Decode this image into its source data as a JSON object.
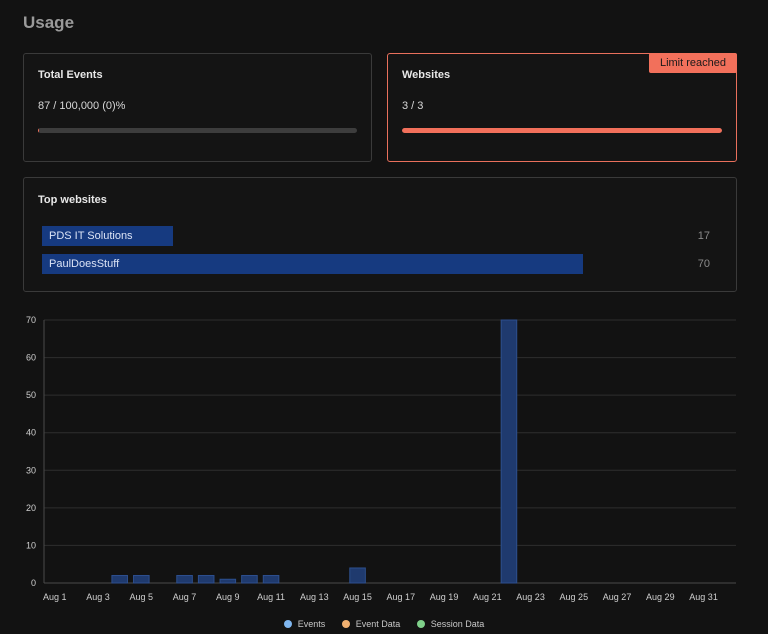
{
  "page": {
    "title": "Usage"
  },
  "total_events": {
    "title": "Total Events",
    "value": "87 / 100,000 (0)%",
    "progress": 0.00087
  },
  "websites": {
    "title": "Websites",
    "value": "3 / 3",
    "progress": 1.0,
    "badge": "Limit reached"
  },
  "top_websites": {
    "title": "Top websites",
    "items": [
      {
        "name": "PDS IT Solutions",
        "count": "17",
        "value": 17
      },
      {
        "name": "PaulDoesStuff",
        "count": "70",
        "value": 70
      }
    ]
  },
  "colors": {
    "accent": "#f2705b",
    "bar": "#163a80",
    "events": "#7fb6ef",
    "event_data": "#f0b070",
    "session_data": "#7fd08a"
  },
  "legend": {
    "events": "Events",
    "events_icon": "dot-icon",
    "event_data": "Event Data",
    "event_data_icon": "dot-icon",
    "session_data": "Session Data",
    "session_data_icon": "dot-icon"
  },
  "chart_data": {
    "type": "bar",
    "x": [
      "Aug 1",
      "Aug 2",
      "Aug 3",
      "Aug 4",
      "Aug 5",
      "Aug 6",
      "Aug 7",
      "Aug 8",
      "Aug 9",
      "Aug 10",
      "Aug 11",
      "Aug 12",
      "Aug 13",
      "Aug 14",
      "Aug 15",
      "Aug 16",
      "Aug 17",
      "Aug 18",
      "Aug 19",
      "Aug 20",
      "Aug 21",
      "Aug 22",
      "Aug 23",
      "Aug 24",
      "Aug 25",
      "Aug 26",
      "Aug 27",
      "Aug 28",
      "Aug 29",
      "Aug 30",
      "Aug 31",
      "Sep 1"
    ],
    "xticks": [
      "Aug 1",
      "Aug 3",
      "Aug 5",
      "Aug 7",
      "Aug 9",
      "Aug 11",
      "Aug 13",
      "Aug 15",
      "Aug 17",
      "Aug 19",
      "Aug 21",
      "Aug 23",
      "Aug 25",
      "Aug 27",
      "Aug 29",
      "Aug 31"
    ],
    "yticks": [
      0,
      10,
      20,
      30,
      40,
      50,
      60,
      70
    ],
    "ylim": [
      0,
      70
    ],
    "grid": true,
    "legend_position": "bottom",
    "series": [
      {
        "name": "Events",
        "values": [
          0,
          0,
          0,
          2,
          2,
          0,
          2,
          2,
          1,
          2,
          2,
          0,
          0,
          0,
          4,
          0,
          0,
          0,
          0,
          0,
          0,
          70,
          0,
          0,
          0,
          0,
          0,
          0,
          0,
          0,
          0,
          0
        ]
      }
    ]
  }
}
